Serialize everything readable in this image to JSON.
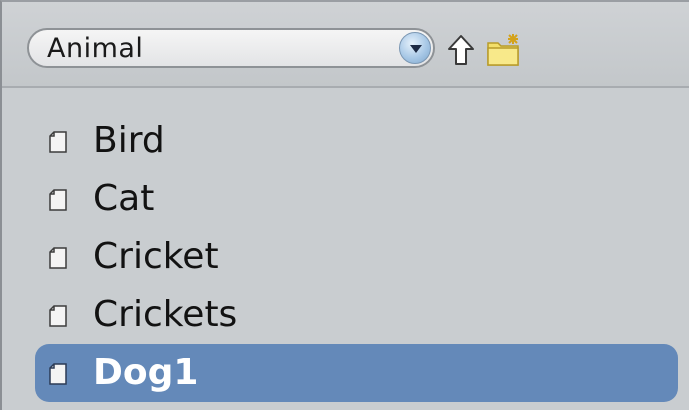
{
  "toolbar": {
    "location_value": "Animal",
    "up_icon": "up-arrow-icon",
    "new_folder_icon": "new-folder-icon",
    "dropdown_icon": "chevron-down-icon"
  },
  "files": {
    "items": [
      {
        "label": "Bird",
        "selected": false
      },
      {
        "label": "Cat",
        "selected": false
      },
      {
        "label": "Cricket",
        "selected": false
      },
      {
        "label": "Crickets",
        "selected": false
      },
      {
        "label": "Dog1",
        "selected": true
      }
    ],
    "item_icon": "document-icon"
  },
  "colors": {
    "selection": "#6489b9",
    "background": "#c9cdd0"
  }
}
